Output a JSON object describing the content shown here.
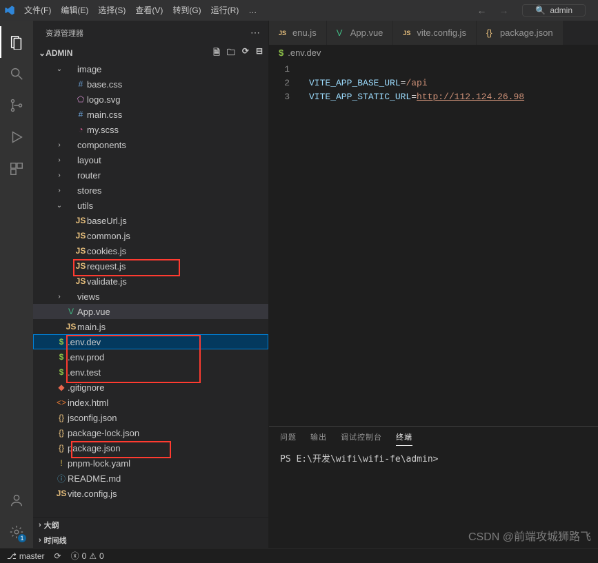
{
  "menu": {
    "items": [
      "文件(F)",
      "编辑(E)",
      "选择(S)",
      "查看(V)",
      "转到(G)",
      "运行(R)",
      "…"
    ]
  },
  "search_label": "admin",
  "activity": {
    "badge": "1"
  },
  "sidebar": {
    "title": "资源管理器",
    "root": "ADMIN",
    "tree": [
      {
        "indent": 1,
        "type": "folder",
        "open": true,
        "label": "image"
      },
      {
        "indent": 2,
        "type": "file",
        "icon": "css",
        "iconTxt": "#",
        "label": "base.css"
      },
      {
        "indent": 2,
        "type": "file",
        "icon": "svg",
        "iconTxt": "⬠",
        "label": "logo.svg"
      },
      {
        "indent": 2,
        "type": "file",
        "icon": "css",
        "iconTxt": "#",
        "label": "main.css"
      },
      {
        "indent": 2,
        "type": "file",
        "icon": "scss",
        "iconTxt": "◔",
        "label": "my.scss"
      },
      {
        "indent": 1,
        "type": "folder",
        "open": false,
        "label": "components"
      },
      {
        "indent": 1,
        "type": "folder",
        "open": false,
        "label": "layout"
      },
      {
        "indent": 1,
        "type": "folder",
        "open": false,
        "label": "router"
      },
      {
        "indent": 1,
        "type": "folder",
        "open": false,
        "label": "stores"
      },
      {
        "indent": 1,
        "type": "folder",
        "open": true,
        "label": "utils"
      },
      {
        "indent": 2,
        "type": "file",
        "icon": "js",
        "iconTxt": "JS",
        "label": "baseUrl.js"
      },
      {
        "indent": 2,
        "type": "file",
        "icon": "js",
        "iconTxt": "JS",
        "label": "common.js"
      },
      {
        "indent": 2,
        "type": "file",
        "icon": "js",
        "iconTxt": "JS",
        "label": "cookies.js"
      },
      {
        "indent": 2,
        "type": "file",
        "icon": "js",
        "iconTxt": "JS",
        "label": "request.js"
      },
      {
        "indent": 2,
        "type": "file",
        "icon": "js",
        "iconTxt": "JS",
        "label": "validate.js"
      },
      {
        "indent": 1,
        "type": "folder",
        "open": false,
        "label": "views"
      },
      {
        "indent": 1,
        "type": "file",
        "icon": "vue",
        "iconTxt": "V",
        "label": "App.vue",
        "activeTab": true
      },
      {
        "indent": 1,
        "type": "file",
        "icon": "js",
        "iconTxt": "JS",
        "label": "main.js"
      },
      {
        "indent": 0,
        "type": "file",
        "icon": "env",
        "iconTxt": "$",
        "label": ".env.dev",
        "selected": true
      },
      {
        "indent": 0,
        "type": "file",
        "icon": "env",
        "iconTxt": "$",
        "label": ".env.prod"
      },
      {
        "indent": 0,
        "type": "file",
        "icon": "env",
        "iconTxt": "$",
        "label": ".env.test"
      },
      {
        "indent": 0,
        "type": "file",
        "icon": "git",
        "iconTxt": "◆",
        "label": ".gitignore"
      },
      {
        "indent": 0,
        "type": "file",
        "icon": "html",
        "iconTxt": "<>",
        "label": "index.html"
      },
      {
        "indent": 0,
        "type": "file",
        "icon": "json",
        "iconTxt": "{}",
        "label": "jsconfig.json"
      },
      {
        "indent": 0,
        "type": "file",
        "icon": "json",
        "iconTxt": "{}",
        "label": "package-lock.json"
      },
      {
        "indent": 0,
        "type": "file",
        "icon": "json",
        "iconTxt": "{}",
        "label": "package.json"
      },
      {
        "indent": 0,
        "type": "file",
        "icon": "lock",
        "iconTxt": "!",
        "label": "pnpm-lock.yaml"
      },
      {
        "indent": 0,
        "type": "file",
        "icon": "md",
        "iconTxt": "ⓘ",
        "label": "README.md"
      },
      {
        "indent": 0,
        "type": "file",
        "icon": "js",
        "iconTxt": "JS",
        "label": "vite.config.js"
      }
    ],
    "sections": [
      "大纲",
      "时间线"
    ]
  },
  "tabs": [
    {
      "icon": "js",
      "iconTxt": "JS",
      "label": "enu.js"
    },
    {
      "icon": "vue",
      "iconTxt": "V",
      "label": "App.vue"
    },
    {
      "icon": "js",
      "iconTxt": "JS",
      "label": "vite.config.js"
    },
    {
      "icon": "json",
      "iconTxt": "{}",
      "label": "package.json"
    }
  ],
  "breadcrumb": {
    "icon": "$",
    "file": ".env.dev"
  },
  "editor": {
    "lines": [
      "1",
      "2",
      "3"
    ],
    "l1": {
      "key": "VITE_APP_BASE_URL",
      "eq": "=",
      "val": "/api"
    },
    "l2": {
      "key": "VITE_APP_STATIC_URL",
      "eq": "=",
      "val": "http://112.124.26.98"
    }
  },
  "panel": {
    "tabs": [
      "问题",
      "输出",
      "调试控制台",
      "终端"
    ],
    "activeIdx": 3,
    "terminal_line": "PS E:\\开发\\wifi\\wifi-fe\\admin>"
  },
  "statusbar": {
    "branch": "master",
    "sync": "⟳",
    "errors": "0",
    "warnings": "0"
  },
  "watermark": "CSDN @前端攻城狮路飞"
}
